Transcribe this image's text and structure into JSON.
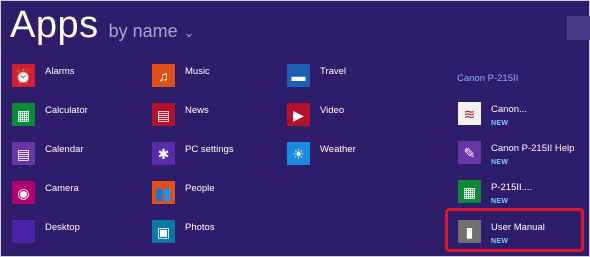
{
  "header": {
    "title": "Apps",
    "sort_label": "by name",
    "sort_chevron": "⌄"
  },
  "columns": [
    {
      "items": [
        {
          "name": "Alarms",
          "icon": "alarm-clock-icon",
          "glyph": "⏰",
          "color": "#d11f30"
        },
        {
          "name": "Calculator",
          "icon": "calculator-icon",
          "glyph": "▦",
          "color": "#0a8a36"
        },
        {
          "name": "Calendar",
          "icon": "calendar-icon",
          "glyph": "▤",
          "color": "#6a35a6"
        },
        {
          "name": "Camera",
          "icon": "camera-icon",
          "glyph": "◉",
          "color": "#b0006e"
        },
        {
          "name": "Desktop",
          "icon": "desktop-icon",
          "glyph": "",
          "color": "#4a23a8"
        }
      ]
    },
    {
      "items": [
        {
          "name": "Music",
          "icon": "headphones-icon",
          "glyph": "♫",
          "color": "#e0501a"
        },
        {
          "name": "News",
          "icon": "newspaper-icon",
          "glyph": "▤",
          "color": "#b3102a"
        },
        {
          "name": "PC settings",
          "icon": "gear-icon",
          "glyph": "✱",
          "color": "#5a2aa8"
        },
        {
          "name": "People",
          "icon": "people-icon",
          "glyph": "👥",
          "color": "#e0501a"
        },
        {
          "name": "Photos",
          "icon": "photos-icon",
          "glyph": "▣",
          "color": "#0a7aa5"
        }
      ]
    },
    {
      "items": [
        {
          "name": "Travel",
          "icon": "suitcase-icon",
          "glyph": "▬",
          "color": "#1d5fb5"
        },
        {
          "name": "Video",
          "icon": "video-icon",
          "glyph": "▶",
          "color": "#b3102a"
        },
        {
          "name": "Weather",
          "icon": "sun-icon",
          "glyph": "☀",
          "color": "#1a8ae0"
        }
      ]
    }
  ],
  "group": {
    "header": "Canon P-215II",
    "items": [
      {
        "name": "Canon...",
        "badge": "NEW",
        "icon": "canon-app-icon",
        "glyph": "≋",
        "color": "#f2f2f2"
      },
      {
        "name": "Canon P-215II Help",
        "badge": "NEW",
        "icon": "help-book-icon",
        "glyph": "✎",
        "color": "#6a35a6"
      },
      {
        "name": "P-215II....",
        "badge": "NEW",
        "icon": "scanner-icon",
        "glyph": "▦",
        "color": "#0a8a36"
      },
      {
        "name": "User Manual",
        "badge": "NEW",
        "icon": "document-icon",
        "glyph": "▮",
        "color": "#707070"
      }
    ]
  }
}
